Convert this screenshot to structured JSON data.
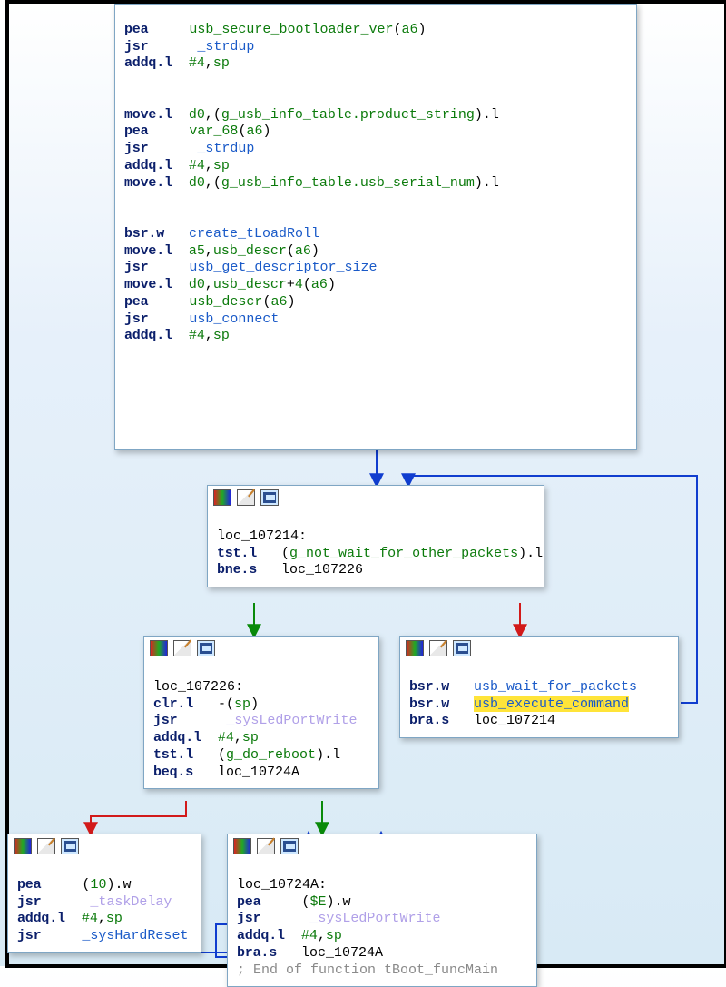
{
  "colors": {
    "edge_uncond": "#103dcf",
    "edge_true": "#0a8a0a",
    "edge_false": "#d21a1a",
    "keyword": "#0b1f6b",
    "identifier": "#0b7a0b",
    "function": "#1a5ac8",
    "func_faint": "#b0a0e8",
    "highlight": "#ffe439"
  },
  "highlighted_symbol": "usb_execute_command",
  "nodes": [
    {
      "lines": [
        {
          "op": "pea",
          "a0": "usb_secure_bootloader_ver",
          "a1": "a6"
        },
        {
          "op": "jsr",
          "a0": "_strdup"
        },
        {
          "op": "addq.l",
          "a0": "#4",
          "a1": "sp"
        },
        {
          "op": "move.l",
          "a0": "d0",
          "a1": "g_usb_info_table.product_string"
        },
        {
          "op": "pea",
          "a0": "var_68",
          "a1": "a6"
        },
        {
          "op": "jsr",
          "a0": "_strdup"
        },
        {
          "op": "addq.l",
          "a0": "#4",
          "a1": "sp"
        },
        {
          "op": "move.l",
          "a0": "d0",
          "a1": "g_usb_info_table.usb_serial_num"
        },
        {
          "op": "bsr.w",
          "a0": "create_tLoadRoll"
        },
        {
          "op": "move.l",
          "a0": "a5",
          "a1": "usb_descr",
          "a2": "a6"
        },
        {
          "op": "jsr",
          "a0": "usb_get_descriptor_size"
        },
        {
          "op": "move.l",
          "a0": "d0",
          "a1": "usb_descr",
          "a2": "4",
          "a3": "a6"
        },
        {
          "op": "pea",
          "a0": "usb_descr",
          "a1": "a6"
        },
        {
          "op": "jsr",
          "a0": "usb_connect"
        },
        {
          "op": "addq.l",
          "a0": "#4",
          "a1": "sp"
        }
      ]
    },
    {
      "label": "loc_107214:",
      "lines": [
        {
          "op": "tst.l",
          "a0": "g_not_wait_for_other_packets"
        },
        {
          "op": "bne.s",
          "a0": "loc_107226"
        }
      ]
    },
    {
      "label": "loc_107226:",
      "lines": [
        {
          "op": "clr.l",
          "a0": "sp"
        },
        {
          "op": "jsr",
          "a0": "_sysLedPortWrite"
        },
        {
          "op": "addq.l",
          "a0": "#4",
          "a1": "sp"
        },
        {
          "op": "tst.l",
          "a0": "g_do_reboot"
        },
        {
          "op": "beq.s",
          "a0": "loc_10724A"
        }
      ]
    },
    {
      "lines": [
        {
          "op": "bsr.w",
          "a0": "usb_wait_for_packets"
        },
        {
          "op": "bsr.w",
          "a0": "usb_execute_command"
        },
        {
          "op": "bra.s",
          "a0": "loc_107214"
        }
      ]
    },
    {
      "lines": [
        {
          "op": "pea",
          "a0": "10"
        },
        {
          "op": "jsr",
          "a0": "_taskDelay"
        },
        {
          "op": "addq.l",
          "a0": "#4",
          "a1": "sp"
        },
        {
          "op": "jsr",
          "a0": "_sysHardReset"
        }
      ]
    },
    {
      "label": "loc_10724A:",
      "lines": [
        {
          "op": "pea",
          "a0": "$E"
        },
        {
          "op": "jsr",
          "a0": "_sysLedPortWrite"
        },
        {
          "op": "addq.l",
          "a0": "#4",
          "a1": "sp"
        },
        {
          "op": "bra.s",
          "a0": "loc_10724A"
        }
      ],
      "comment": "; End of function tBoot_funcMain"
    }
  ]
}
